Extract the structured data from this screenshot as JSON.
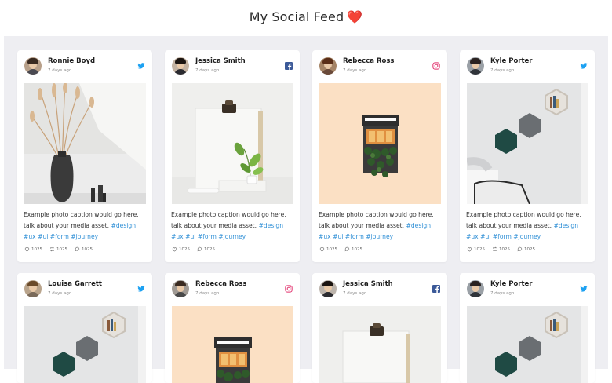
{
  "page": {
    "title": "My Social Feed",
    "title_emoji": "❤️"
  },
  "colors": {
    "twitter": "#1da1f2",
    "facebook": "#3b5998",
    "instagram": "#e1306c",
    "hashtag": "#2f8fd6",
    "feed_bg": "#eeeef2"
  },
  "posts": [
    {
      "user": "Ronnie Boyd",
      "time": "7 days ago",
      "network": "twitter-icon",
      "image": "vase-with-dried-grass",
      "caption": "Example photo caption would go here, talk about your media asset.",
      "tag1": "#design",
      "tags2": "#ux #ui #form #journey",
      "likes": "1025",
      "retweets": "1025",
      "comments": "1025"
    },
    {
      "user": "Jessica Smith",
      "time": "7 days ago",
      "network": "facebook-icon",
      "image": "clipboard-with-plant",
      "caption": "Example photo caption would go here, talk about your media asset.",
      "tag1": "#design",
      "tags2": "#ux #ui #form #journey",
      "likes": "1025",
      "comments": "1025"
    },
    {
      "user": "Rebecca Ross",
      "time": "7 days ago",
      "network": "instagram-icon",
      "image": "storefront-miniature",
      "caption": "Example photo caption would go here, talk about your media asset.",
      "tag1": "#design",
      "tags2": "#ux #ui #form #journey",
      "likes": "1025",
      "comments": "1025"
    },
    {
      "user": "Kyle Porter",
      "time": "7 days ago",
      "network": "twitter-icon",
      "image": "hexagon-shelves",
      "caption": "Example photo caption would go here, talk about your media asset.",
      "tag1": "#design",
      "tags2": "#ux #ui #form #journey",
      "likes": "1025",
      "retweets": "1025",
      "comments": "1025"
    },
    {
      "user": "Louisa Garrett",
      "time": "7 days ago",
      "network": "twitter-icon",
      "image": "hexagon-shelves"
    },
    {
      "user": "Rebecca Ross",
      "time": "7 days ago",
      "network": "instagram-icon",
      "image": "storefront-miniature"
    },
    {
      "user": "Jessica Smith",
      "time": "7 days ago",
      "network": "facebook-icon",
      "image": "clipboard-with-plant"
    },
    {
      "user": "Kyle Porter",
      "time": "7 days ago",
      "network": "twitter-icon",
      "image": "hexagon-shelves"
    }
  ]
}
